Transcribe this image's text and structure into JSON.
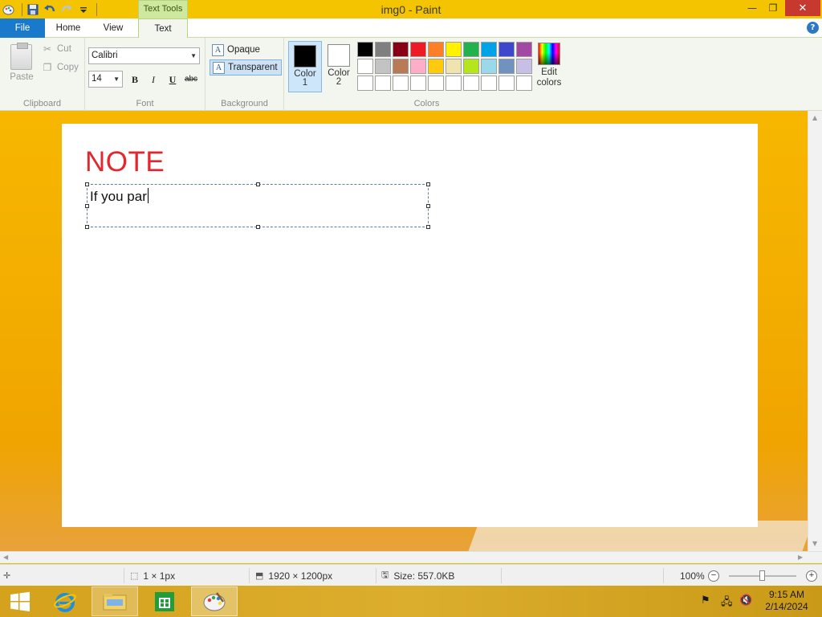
{
  "window": {
    "title": "img0 - Paint",
    "context_tab": "Text Tools",
    "minimize": "—",
    "maximize": "❐",
    "close": "✕"
  },
  "tabs": {
    "file": "File",
    "home": "Home",
    "view": "View",
    "text": "Text",
    "help": "?"
  },
  "clipboard": {
    "paste": "Paste",
    "cut": "Cut",
    "copy": "Copy",
    "group": "Clipboard"
  },
  "font": {
    "family": "Calibri",
    "size": "14",
    "bold": "B",
    "italic": "I",
    "underline": "U",
    "strike": "abc",
    "group": "Font"
  },
  "background": {
    "opaque": "Opaque",
    "transparent": "Transparent",
    "group": "Background"
  },
  "colors": {
    "color1_label_a": "Color",
    "color1_label_b": "1",
    "color2_label_a": "Color",
    "color2_label_b": "2",
    "color1": "#000000",
    "color2": "#ffffff",
    "edit_a": "Edit",
    "edit_b": "colors",
    "group": "Colors",
    "palette": [
      "#000000",
      "#7f7f7f",
      "#880015",
      "#ed1c24",
      "#ff7f27",
      "#fff200",
      "#22b14c",
      "#00a2e8",
      "#3f48cc",
      "#a349a4",
      "#ffffff",
      "#c3c3c3",
      "#b97a57",
      "#ffaec9",
      "#ffc90e",
      "#efe4b0",
      "#b5e61d",
      "#99d9ea",
      "#7092be",
      "#c8bfe7",
      "#ffffff",
      "#ffffff",
      "#ffffff",
      "#ffffff",
      "#ffffff",
      "#ffffff",
      "#ffffff",
      "#ffffff",
      "#ffffff",
      "#ffffff"
    ]
  },
  "canvas": {
    "heading": "NOTE",
    "heading_color": "#e5262e",
    "textbox_text": "If you par"
  },
  "status": {
    "selection": "1 × 1px",
    "image_size": "1920 × 1200px",
    "file_size": "Size: 557.0KB",
    "zoom": "100%",
    "zoom_level": 0.5
  },
  "taskbar": {
    "time": "9:15 AM",
    "date": "2/14/2024"
  }
}
